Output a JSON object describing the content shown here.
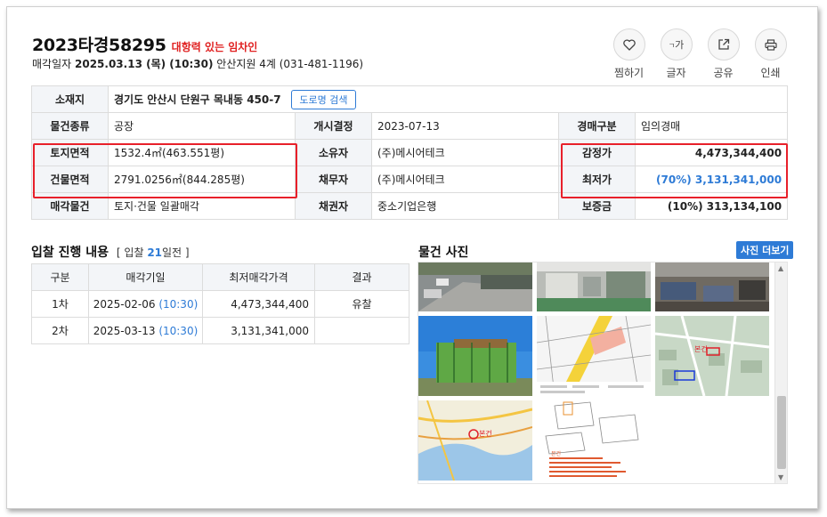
{
  "header": {
    "case_no": "2023타경58295",
    "tag": "대항력 있는 임차인",
    "sale_label": "매각일자",
    "sale_date": "2025.03.13 (목) (10:30)",
    "court": "안산지원 4계 (031-481-1196)"
  },
  "actions": [
    {
      "label": "찜하기",
      "icon": "heart-icon"
    },
    {
      "label": "글자",
      "icon": "font-size-icon"
    },
    {
      "label": "공유",
      "icon": "share-icon"
    },
    {
      "label": "인쇄",
      "icon": "print-icon"
    }
  ],
  "info": {
    "location_label": "소재지",
    "location_value": "경기도 안산시 단원구 목내동 450-7",
    "road_btn": "도로명 검색",
    "type_label": "물건종류",
    "type_value": "공장",
    "start_label": "개시결정",
    "start_value": "2023-07-13",
    "kind_label": "경매구분",
    "kind_value": "임의경매",
    "land_label": "토지면적",
    "land_value": "1532.4㎡(463.551평)",
    "owner_label": "소유자",
    "owner_value": "(주)메시어테크",
    "appraisal_label": "감정가",
    "appraisal_value": "4,473,344,400",
    "building_label": "건물면적",
    "building_value": "2791.0256㎡(844.285평)",
    "debtor_label": "채무자",
    "debtor_value": "(주)메시어테크",
    "min_label": "최저가",
    "min_value": "(70%) 3,131,341,000",
    "sale_item_label": "매각물건",
    "sale_item_value": "토지·건물 일괄매각",
    "creditor_label": "채권자",
    "creditor_value": "중소기업은행",
    "deposit_label": "보증금",
    "deposit_value": "(10%) 313,134,100"
  },
  "bids": {
    "title": "입찰 진행 내용",
    "note_prefix": "[ 입찰",
    "note_days": "21",
    "note_suffix": "일전 ]",
    "headers": [
      "구분",
      "매각기일",
      "최저매각가격",
      "결과"
    ],
    "rows": [
      {
        "round": "1차",
        "date": "2025-02-06",
        "time": "(10:30)",
        "price": "4,473,344,400",
        "result": "유찰"
      },
      {
        "round": "2차",
        "date": "2025-03-13",
        "time": "(10:30)",
        "price": "3,131,341,000",
        "result": ""
      }
    ]
  },
  "photos": {
    "title": "물건 사진",
    "more_btn": "사진 더보기",
    "map_label_1": "본건",
    "map_label_2": "본건",
    "note_label": "본건"
  },
  "colors": {
    "accent": "#2e7bd6",
    "highlight": "#e8202a",
    "tag": "#e02020"
  }
}
